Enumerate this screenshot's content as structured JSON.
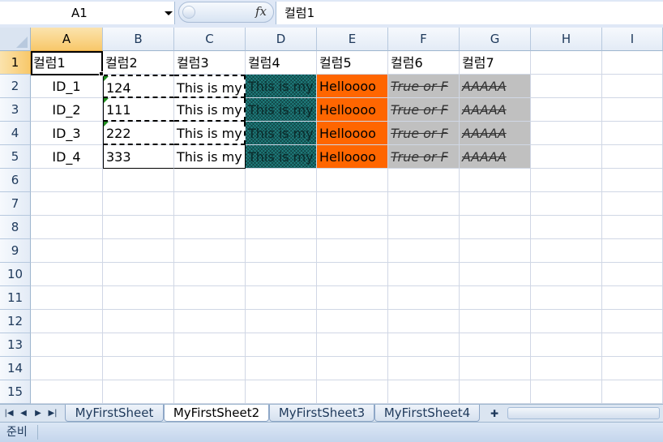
{
  "formula_bar": {
    "name_box": "A1",
    "fx_label": "fx",
    "formula_value": "컬럼1"
  },
  "columns": [
    "A",
    "B",
    "C",
    "D",
    "E",
    "F",
    "G",
    "H",
    "I"
  ],
  "rows": [
    "1",
    "2",
    "3",
    "4",
    "5",
    "6",
    "7",
    "8",
    "9",
    "10",
    "11",
    "12",
    "13",
    "14",
    "15"
  ],
  "cells": {
    "header": [
      "컬럼1",
      "컬럼2",
      "컬럼3",
      "컬럼4",
      "컬럼5",
      "컬럼6",
      "컬럼7"
    ],
    "data": [
      [
        "ID_1",
        "124",
        "This is my",
        "This is my",
        "Helloooo",
        "True or F",
        "AAAAA"
      ],
      [
        "ID_2",
        "111",
        "This is my",
        "This is my",
        "Helloooo",
        "True or F",
        "AAAAA"
      ],
      [
        "ID_3",
        "222",
        "This is my",
        "This is my",
        "Helloooo",
        "True or F",
        "AAAAA"
      ],
      [
        "ID_4",
        "333",
        "This is my",
        "This is my",
        "Helloooo",
        "True or F",
        "AAAAA"
      ]
    ]
  },
  "sheet_tabs": [
    "MyFirstSheet",
    "MyFirstSheet2",
    "MyFirstSheet3",
    "MyFirstSheet4"
  ],
  "active_sheet": "MyFirstSheet2",
  "status": {
    "ready": "준비"
  },
  "colors": {
    "teal_fill": "#1f7f7f",
    "orange_fill": "#ff6600",
    "gray_fill": "#c0c0c0",
    "active_header": "#f8c86a"
  }
}
